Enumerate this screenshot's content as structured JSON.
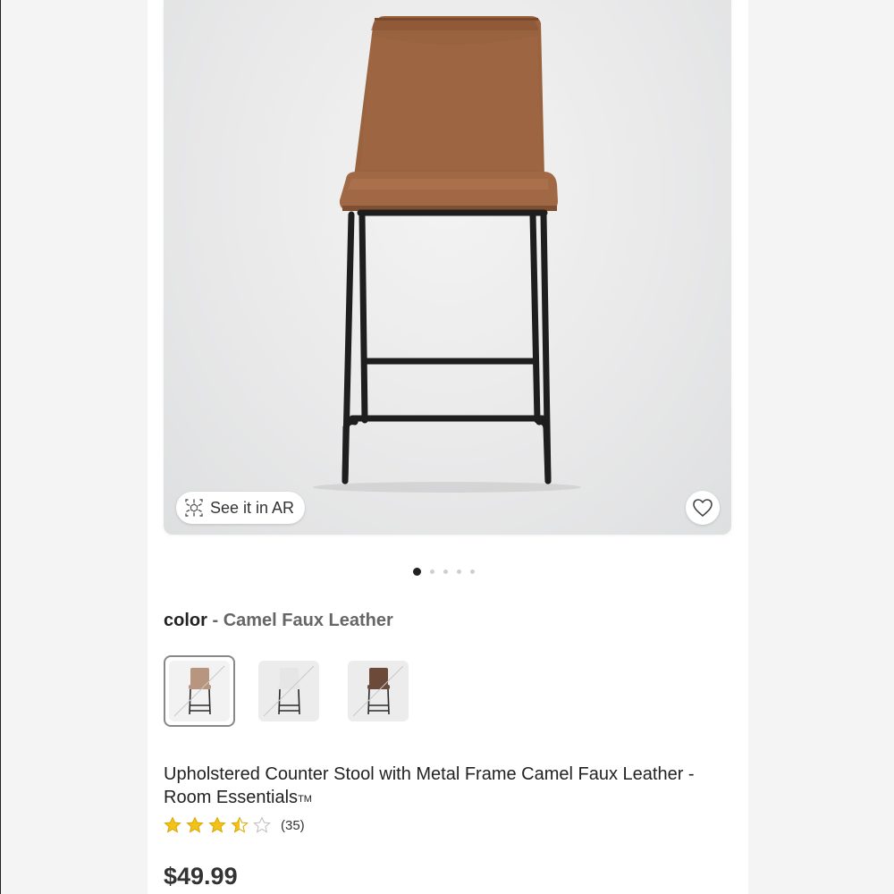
{
  "product": {
    "ar_button_label": "See it in AR",
    "color_key": "color",
    "color_separator": " - ",
    "color_value": "Camel Faux Leather",
    "title_main": "Upholstered Counter Stool with Metal Frame Camel Faux Leather - Room Essentials",
    "title_tm": "TM",
    "rating_value": 3.5,
    "rating_max": 5,
    "rating_count": "(35)",
    "price": "$49.99"
  },
  "carousel": {
    "total": 5,
    "active_index": 0
  },
  "swatches": [
    {
      "name": "Camel Faux Leather",
      "seat_color": "#b8957e",
      "selected": true
    },
    {
      "name": "White",
      "seat_color": "#e6e6e6",
      "selected": false
    },
    {
      "name": "Brown",
      "seat_color": "#6b4a39",
      "selected": false
    }
  ],
  "colors": {
    "star_filled": "#f2c21b",
    "star_empty": "#bdbdbd",
    "upholstery": "#9a6340",
    "frame": "#1e1e1e"
  },
  "icons": {
    "ar": "ar-cube-icon",
    "favorite": "heart-outline-icon",
    "star": "star-icon"
  }
}
